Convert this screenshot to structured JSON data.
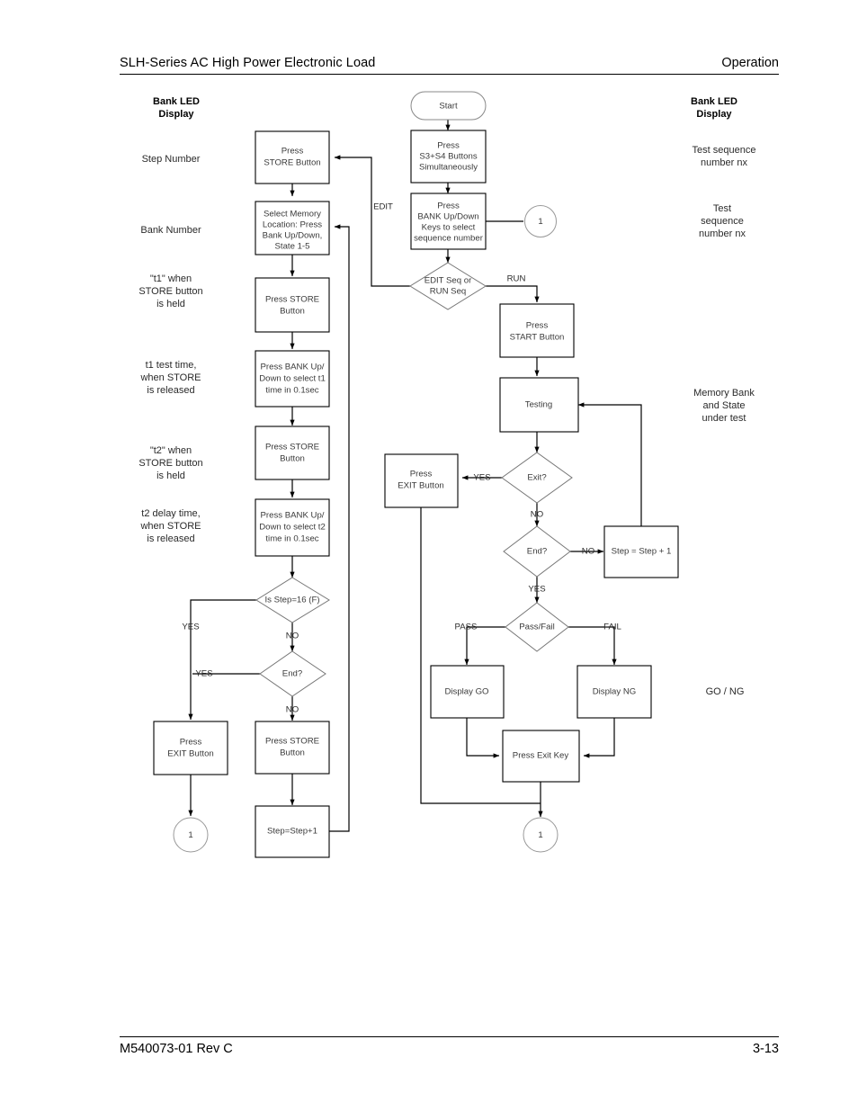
{
  "header": {
    "left_title": "SLH-Series AC High Power Electronic Load",
    "right_title": "Operation"
  },
  "footer": {
    "doc_number": "M540073-01 Rev C",
    "page_number": "3-13"
  },
  "left_column": {
    "heading_line1": "Bank LED",
    "heading_line2": "Display",
    "notes": [
      {
        "id": "note-step-number",
        "lines": [
          "Step Number"
        ]
      },
      {
        "id": "note-bank-number",
        "lines": [
          "Bank Number"
        ]
      },
      {
        "id": "note-t1-held",
        "lines": [
          "\"t1\" when",
          "STORE button",
          "is held"
        ]
      },
      {
        "id": "note-t1-released",
        "lines": [
          "t1 test time,",
          "when STORE",
          "is released"
        ]
      },
      {
        "id": "note-t2-held",
        "lines": [
          "\"t2\" when",
          "STORE button",
          "is held"
        ]
      },
      {
        "id": "note-t2-released",
        "lines": [
          "t2 delay time,",
          "when STORE",
          "is released"
        ]
      }
    ]
  },
  "right_column": {
    "heading_line1": "Bank LED",
    "heading_line2": "Display",
    "notes": [
      {
        "id": "note-test-seq-1",
        "lines": [
          "Test sequence",
          "number nx"
        ]
      },
      {
        "id": "note-test-seq-2",
        "lines": [
          "Test",
          "sequence",
          "number nx"
        ]
      },
      {
        "id": "note-memory-bank",
        "lines": [
          "Memory Bank",
          "and State",
          "under test"
        ]
      },
      {
        "id": "note-go-ng",
        "lines": [
          "GO / NG"
        ]
      }
    ]
  },
  "nodes": {
    "start": {
      "lines": [
        "Start"
      ]
    },
    "press_s3_s4": {
      "lines": [
        "Press",
        "S3+S4 Buttons",
        "Simultaneously"
      ]
    },
    "press_bank_seq": {
      "lines": [
        "Press",
        "BANK Up/Down",
        "Keys  to select",
        "sequence number"
      ]
    },
    "edit_or_run": {
      "lines": [
        "EDIT Seq or",
        "RUN Seq"
      ]
    },
    "connector_top_right": {
      "lines": [
        "1"
      ]
    },
    "press_store_1": {
      "lines": [
        "Press",
        "STORE Button"
      ]
    },
    "select_memory": {
      "lines": [
        "Select Memory",
        "Location: Press",
        "Bank Up/Down,",
        "State 1-5"
      ]
    },
    "press_store_2": {
      "lines": [
        "Press STORE",
        "Button"
      ]
    },
    "press_bank_t1": {
      "lines": [
        "Press BANK Up/",
        "Down to select t1",
        "time in 0.1sec"
      ]
    },
    "press_store_3": {
      "lines": [
        "Press STORE",
        "Button"
      ]
    },
    "press_bank_t2": {
      "lines": [
        "Press BANK Up/",
        "Down to select t2",
        "time in 0.1sec"
      ]
    },
    "is_step_16": {
      "lines": [
        "Is Step=16 (F)"
      ]
    },
    "end_left": {
      "lines": [
        "End?"
      ]
    },
    "press_exit_left": {
      "lines": [
        "Press",
        "EXIT Button"
      ]
    },
    "press_store_4": {
      "lines": [
        "Press STORE",
        "Button"
      ]
    },
    "step_plus_1_left": {
      "lines": [
        "Step=Step+1"
      ]
    },
    "connector_bottom_left": {
      "lines": [
        "1"
      ]
    },
    "press_start": {
      "lines": [
        "Press",
        "START Button"
      ]
    },
    "testing": {
      "lines": [
        "Testing"
      ]
    },
    "exit_q": {
      "lines": [
        "Exit?"
      ]
    },
    "press_exit_mid": {
      "lines": [
        "Press",
        "EXIT Button"
      ]
    },
    "end_right": {
      "lines": [
        "End?"
      ]
    },
    "step_plus_1_right": {
      "lines": [
        "Step = Step + 1"
      ]
    },
    "pass_fail": {
      "lines": [
        "Pass/Fail"
      ]
    },
    "display_go": {
      "lines": [
        "Display GO"
      ]
    },
    "display_ng": {
      "lines": [
        "Display NG"
      ]
    },
    "press_exit_key": {
      "lines": [
        "Press Exit Key"
      ]
    },
    "connector_bottom_center": {
      "lines": [
        "1"
      ]
    }
  },
  "edge_labels": {
    "edit": "EDIT",
    "run": "RUN",
    "yes_step16": "YES",
    "no_step16": "NO",
    "yes_end_left": "YES",
    "no_end_left": "NO",
    "yes_exit": "YES",
    "no_exit": "NO",
    "no_end_right": "NO",
    "yes_end_right": "YES",
    "pass": "PASS",
    "fail": "FAIL"
  },
  "colors": {
    "ink": "#000000",
    "box_stroke": "#000000",
    "diamond_stroke": "#777777",
    "text": "#3a3a3a",
    "background": "#ffffff"
  }
}
